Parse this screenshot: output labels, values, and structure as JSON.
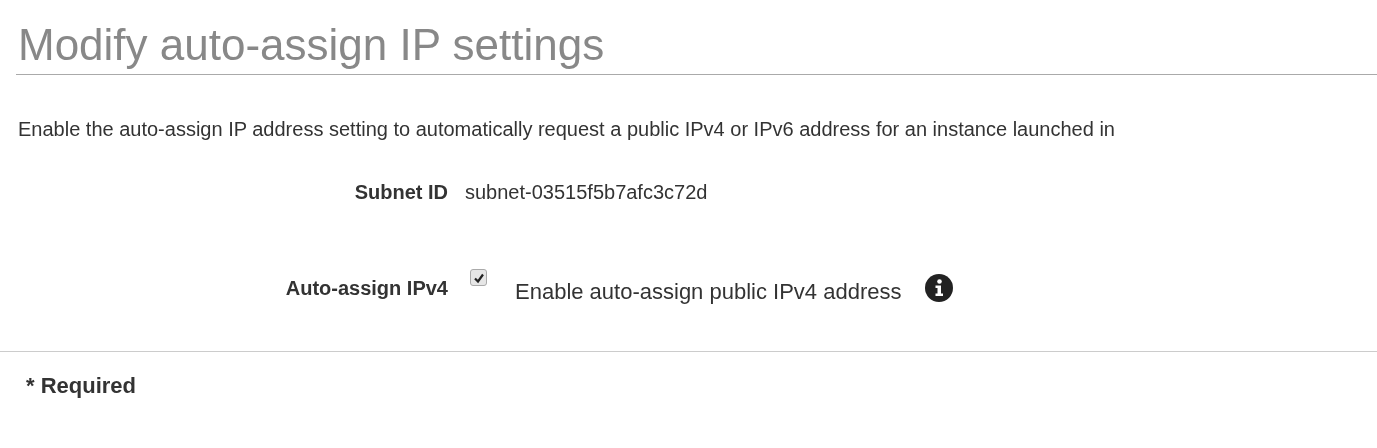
{
  "title": "Modify auto-assign IP settings",
  "description": "Enable the auto-assign IP address setting to automatically request a public IPv4 or IPv6 address for an instance launched in",
  "fields": [
    {
      "kind": "text",
      "label": "Subnet ID",
      "value": "subnet-03515f5b7afc3c72d"
    },
    {
      "kind": "checkbox",
      "label": "Auto-assign IPv4",
      "checked": true,
      "option": "Enable auto-assign public IPv4 address"
    }
  ],
  "footer": "* Required"
}
